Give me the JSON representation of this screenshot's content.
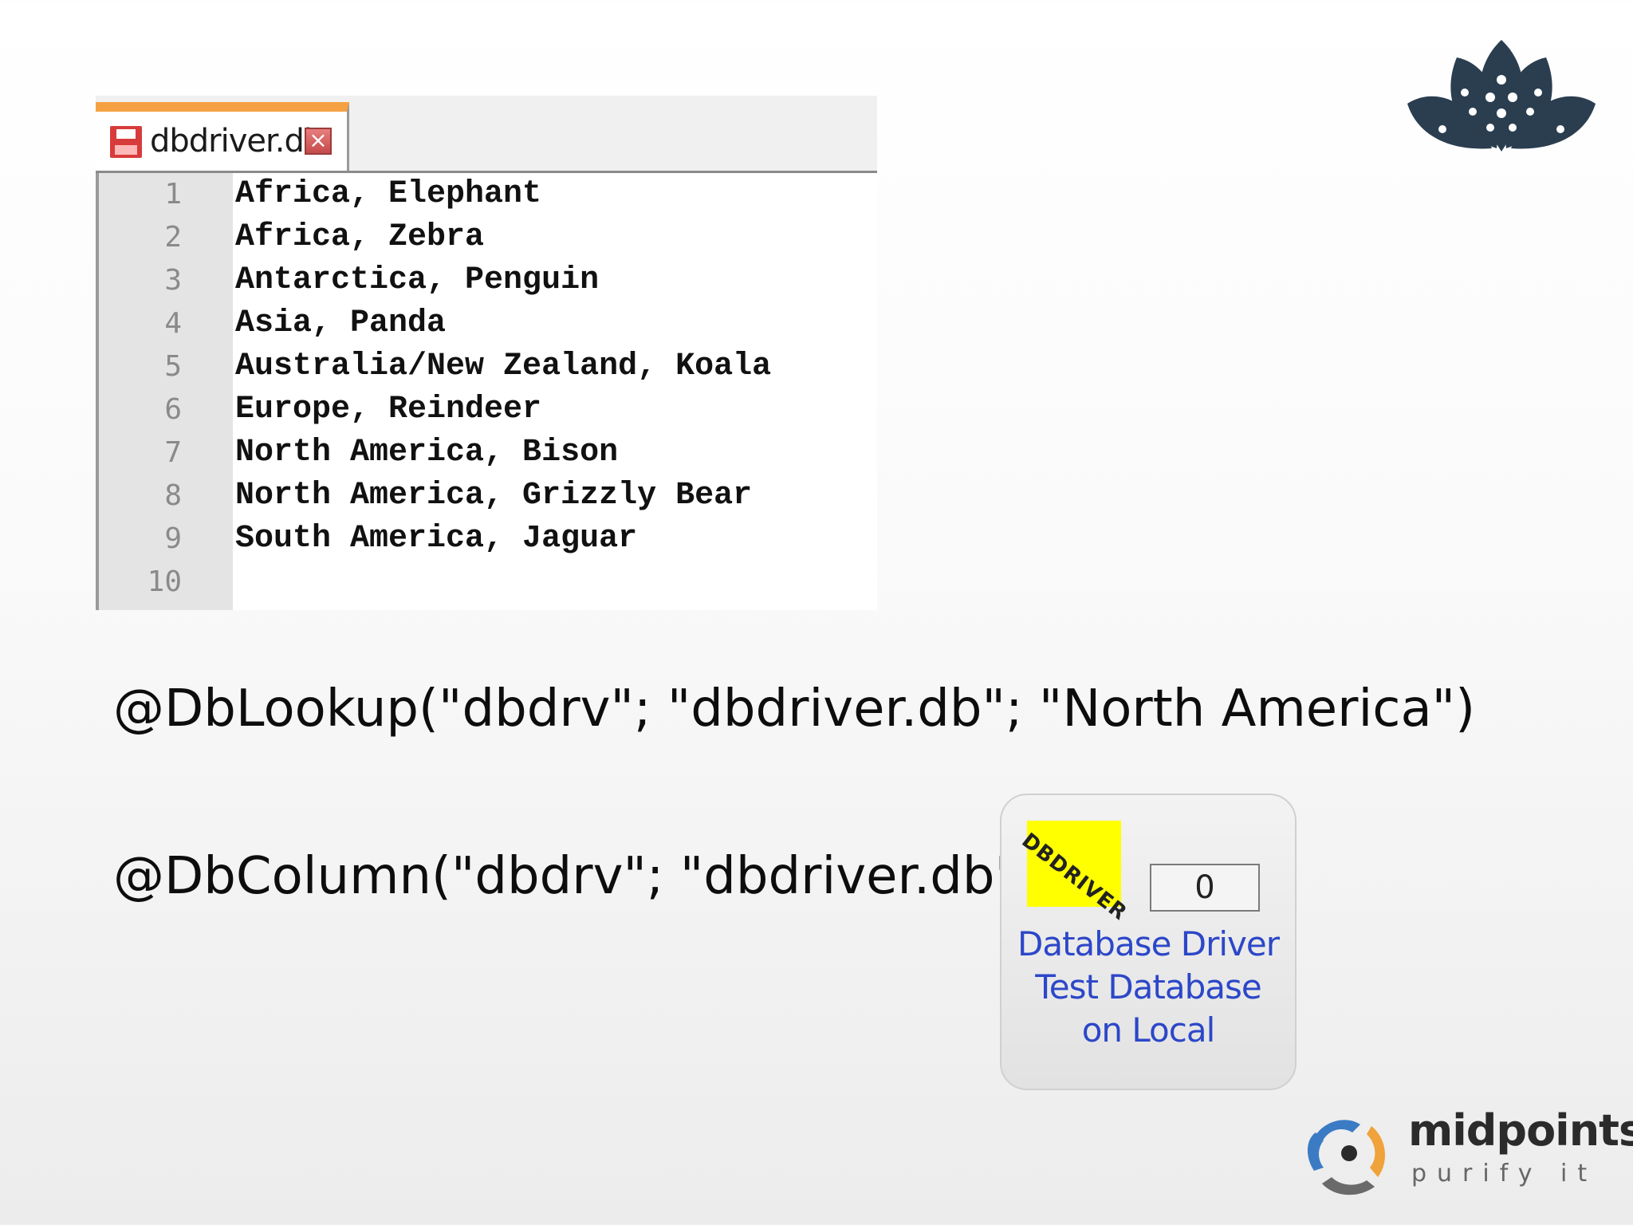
{
  "editor": {
    "tab_title": "dbdriver.db",
    "tab_close_glyph": "×",
    "lines": [
      {
        "num": "1",
        "text": "Africa, Elephant"
      },
      {
        "num": "2",
        "text": "Africa, Zebra"
      },
      {
        "num": "3",
        "text": "Antarctica, Penguin"
      },
      {
        "num": "4",
        "text": "Asia, Panda"
      },
      {
        "num": "5",
        "text": "Australia/New Zealand, Koala"
      },
      {
        "num": "6",
        "text": "Europe, Reindeer"
      },
      {
        "num": "7",
        "text": "North America, Bison"
      },
      {
        "num": "8",
        "text": "North America, Grizzly Bear"
      },
      {
        "num": "9",
        "text": "South America, Jaguar"
      },
      {
        "num": "10",
        "text": ""
      }
    ]
  },
  "formulas": {
    "lookup": "@DbLookup(\"dbdrv\"; \"dbdriver.db\"; \"North America\")",
    "column": "@DbColumn(\"dbdrv\"; \"dbdriver.db\")"
  },
  "driver_tile": {
    "logo_text": "DBDRIVER",
    "counter": "0",
    "caption_line1": "Database Driver",
    "caption_line2": "Test Database",
    "caption_line3": "on Local"
  },
  "branding": {
    "company": "midpoints",
    "tagline": "purify it"
  },
  "colors": {
    "tab_accent": "#f5a043",
    "driver_logo_bg": "#ffff00",
    "driver_caption": "#2c47c8",
    "lotus": "#2b3e50"
  },
  "icons": {
    "tab_file": "floppy-disk-icon",
    "tab_close": "close-icon",
    "lotus_logo": "lotus-logo-icon",
    "midpoints_logo": "midpoints-logo-icon"
  }
}
